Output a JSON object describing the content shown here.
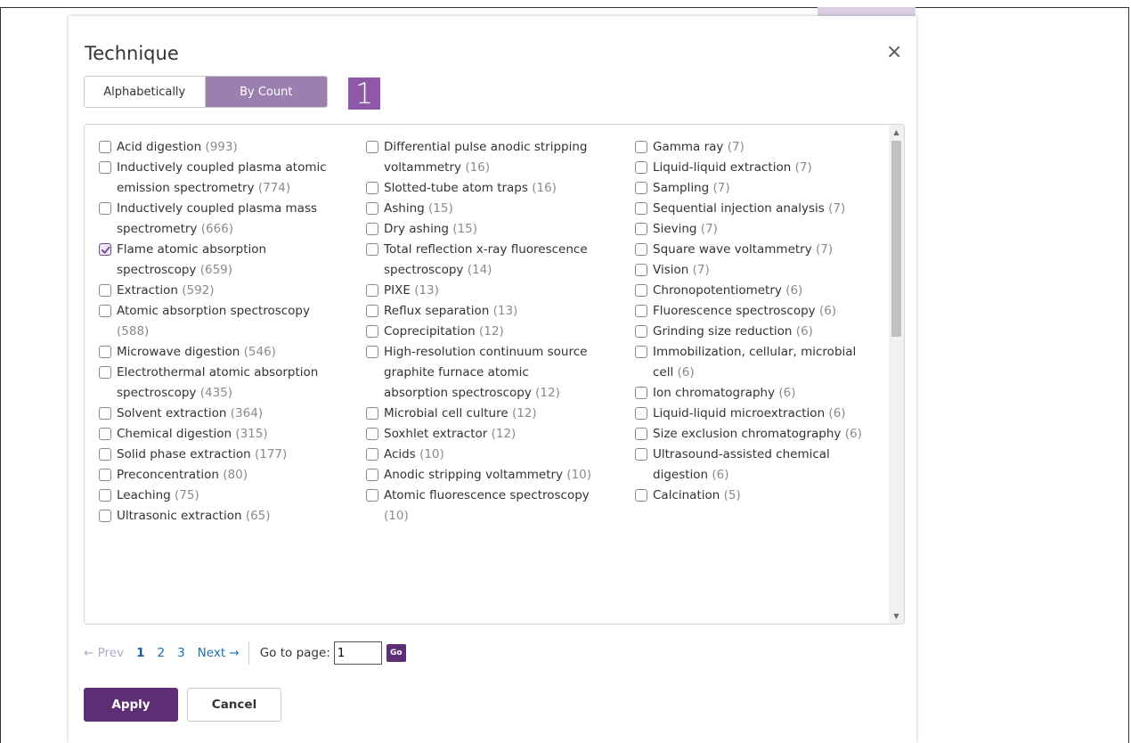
{
  "modal": {
    "title": "Technique",
    "close_label": "×",
    "badge": "1",
    "sort": {
      "alphabetically": "Alphabetically",
      "by_count": "By Count",
      "selected": "By Count"
    },
    "columns": [
      [
        {
          "label": "Acid digestion",
          "count": "(993)",
          "checked": false
        },
        {
          "label": "Inductively coupled plasma atomic emission spectrometry",
          "count": "(774)",
          "checked": false
        },
        {
          "label": "Inductively coupled plasma mass spectrometry",
          "count": "(666)",
          "checked": false
        },
        {
          "label": "Flame atomic absorption spectroscopy",
          "count": "(659)",
          "checked": true
        },
        {
          "label": "Extraction",
          "count": "(592)",
          "checked": false
        },
        {
          "label": "Atomic absorption spectroscopy",
          "count": "(588)",
          "checked": false
        },
        {
          "label": "Microwave digestion",
          "count": "(546)",
          "checked": false
        },
        {
          "label": "Electrothermal atomic absorption spectroscopy",
          "count": "(435)",
          "checked": false
        },
        {
          "label": "Solvent extraction",
          "count": "(364)",
          "checked": false
        },
        {
          "label": "Chemical digestion",
          "count": "(315)",
          "checked": false
        },
        {
          "label": "Solid phase extraction",
          "count": "(177)",
          "checked": false
        },
        {
          "label": "Preconcentration",
          "count": "(80)",
          "checked": false
        },
        {
          "label": "Leaching",
          "count": "(75)",
          "checked": false
        },
        {
          "label": "Ultrasonic extraction",
          "count": "(65)",
          "checked": false
        }
      ],
      [
        {
          "label": "Differential pulse anodic stripping voltammetry",
          "count": "(16)",
          "checked": false
        },
        {
          "label": "Slotted-tube atom traps",
          "count": "(16)",
          "checked": false
        },
        {
          "label": "Ashing",
          "count": "(15)",
          "checked": false
        },
        {
          "label": "Dry ashing",
          "count": "(15)",
          "checked": false
        },
        {
          "label": "Total reflection x-ray fluorescence spectroscopy",
          "count": "(14)",
          "checked": false
        },
        {
          "label": "PIXE",
          "count": "(13)",
          "checked": false
        },
        {
          "label": "Reflux separation",
          "count": "(13)",
          "checked": false
        },
        {
          "label": "Coprecipitation",
          "count": "(12)",
          "checked": false
        },
        {
          "label": "High-resolution continuum source graphite furnace atomic absorption spectroscopy",
          "count": "(12)",
          "checked": false
        },
        {
          "label": "Microbial cell culture",
          "count": "(12)",
          "checked": false
        },
        {
          "label": "Soxhlet extractor",
          "count": "(12)",
          "checked": false
        },
        {
          "label": "Acids",
          "count": "(10)",
          "checked": false
        },
        {
          "label": "Anodic stripping voltammetry",
          "count": "(10)",
          "checked": false
        },
        {
          "label": "Atomic fluorescence spectroscopy",
          "count": "(10)",
          "checked": false
        }
      ],
      [
        {
          "label": "Gamma ray",
          "count": "(7)",
          "checked": false
        },
        {
          "label": "Liquid-liquid extraction",
          "count": "(7)",
          "checked": false
        },
        {
          "label": "Sampling",
          "count": "(7)",
          "checked": false
        },
        {
          "label": "Sequential injection analysis",
          "count": "(7)",
          "checked": false
        },
        {
          "label": "Sieving",
          "count": "(7)",
          "checked": false
        },
        {
          "label": "Square wave voltammetry",
          "count": "(7)",
          "checked": false
        },
        {
          "label": "Vision",
          "count": "(7)",
          "checked": false
        },
        {
          "label": "Chronopotentiometry",
          "count": "(6)",
          "checked": false
        },
        {
          "label": "Fluorescence spectroscopy",
          "count": "(6)",
          "checked": false
        },
        {
          "label": "Grinding size reduction",
          "count": "(6)",
          "checked": false
        },
        {
          "label": "Immobilization, cellular, microbial cell",
          "count": "(6)",
          "checked": false
        },
        {
          "label": "Ion chromatography",
          "count": "(6)",
          "checked": false
        },
        {
          "label": "Liquid-liquid microextraction",
          "count": "(6)",
          "checked": false
        },
        {
          "label": "Size exclusion chromatography",
          "count": "(6)",
          "checked": false
        },
        {
          "label": "Ultrasound-assisted chemical digestion",
          "count": "(6)",
          "checked": false
        },
        {
          "label": "Calcination",
          "count": "(5)",
          "checked": false
        }
      ]
    ],
    "pagination": {
      "prev": "← Prev",
      "pages": [
        "1",
        "2",
        "3"
      ],
      "current": "1",
      "next": "Next →",
      "goto_label": "Go to page:",
      "goto_value": "1",
      "go_label": "Go"
    },
    "apply_label": "Apply",
    "cancel_label": "Cancel"
  },
  "colors": {
    "accent": "#5d2e74",
    "segment_active": "#9b7fae",
    "badge": "#8f58a8",
    "count_text": "#8a8a8a"
  }
}
